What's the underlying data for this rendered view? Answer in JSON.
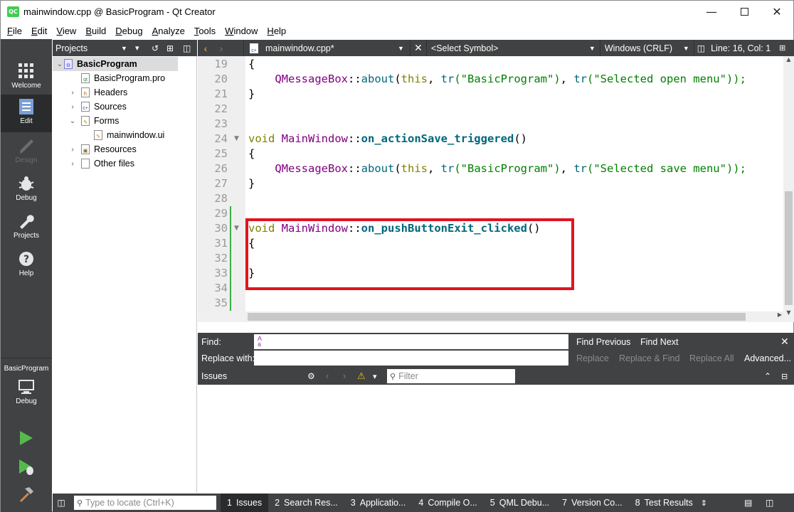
{
  "window": {
    "title": "mainwindow.cpp @ BasicProgram - Qt Creator",
    "app_icon": "QC"
  },
  "menu": [
    "File",
    "Edit",
    "View",
    "Build",
    "Debug",
    "Analyze",
    "Tools",
    "Window",
    "Help"
  ],
  "modes": {
    "welcome": "Welcome",
    "edit": "Edit",
    "design": "Design",
    "debug": "Debug",
    "projects": "Projects",
    "help": "Help",
    "kit_project": "BasicProgram",
    "kit_build": "Debug"
  },
  "projects_panel": {
    "header": "Projects",
    "tree": {
      "root": "BasicProgram",
      "pro": "BasicProgram.pro",
      "headers": "Headers",
      "sources": "Sources",
      "forms": "Forms",
      "ui": "mainwindow.ui",
      "resources": "Resources",
      "other": "Other files"
    }
  },
  "editor_toolbar": {
    "file": "mainwindow.cpp*",
    "symbol": "<Select Symbol>",
    "line_endings": "Windows (CRLF)",
    "position": "Line: 16, Col: 1"
  },
  "code": {
    "line_numbers": [
      "19",
      "20",
      "21",
      "22",
      "23",
      "24",
      "25",
      "26",
      "27",
      "28",
      "29",
      "30",
      "31",
      "32",
      "33",
      "34",
      "35"
    ],
    "l19": "{",
    "l20": {
      "cls": "QMessageBox",
      "sep": "::",
      "fn": "about",
      "p1": "(",
      "this": "this",
      "c1": ", ",
      "tr1": "tr",
      "s1": "(\"BasicProgram\")",
      "c2": ", ",
      "tr2": "tr",
      "s2": "(\"Selected open menu\"));"
    },
    "l21": "}",
    "l24": {
      "kw": "void",
      "cls": "MainWindow",
      "sep": "::",
      "fn": "on_actionSave_triggered",
      "end": "()"
    },
    "l25": "{",
    "l26": {
      "cls": "QMessageBox",
      "sep": "::",
      "fn": "about",
      "p1": "(",
      "this": "this",
      "c1": ", ",
      "tr1": "tr",
      "s1": "(\"BasicProgram\")",
      "c2": ", ",
      "tr2": "tr",
      "s2": "(\"Selected save menu\"));"
    },
    "l27": "}",
    "l30": {
      "kw": "void",
      "cls": "MainWindow",
      "sep": "::",
      "fn": "on_pushButtonExit_clicked",
      "end": "()"
    },
    "l31": "{",
    "l33": "}"
  },
  "find": {
    "find_label": "Find:",
    "replace_label": "Replace with:",
    "find_previous": "Find Previous",
    "find_next": "Find Next",
    "replace": "Replace",
    "replace_find": "Replace & Find",
    "replace_all": "Replace All",
    "advanced": "Advanced..."
  },
  "issues": {
    "title": "Issues",
    "filter_placeholder": "Filter"
  },
  "status": {
    "locate_placeholder": "Type to locate (Ctrl+K)",
    "tabs": [
      {
        "n": "1",
        "label": "Issues"
      },
      {
        "n": "2",
        "label": "Search Res..."
      },
      {
        "n": "3",
        "label": "Applicatio..."
      },
      {
        "n": "4",
        "label": "Compile O..."
      },
      {
        "n": "5",
        "label": "QML Debu..."
      },
      {
        "n": "7",
        "label": "Version Co..."
      },
      {
        "n": "8",
        "label": "Test Results"
      }
    ]
  },
  "colors": {
    "highlight_box": "#e0141e",
    "panel": "#404244",
    "sidebar": "#404244"
  }
}
